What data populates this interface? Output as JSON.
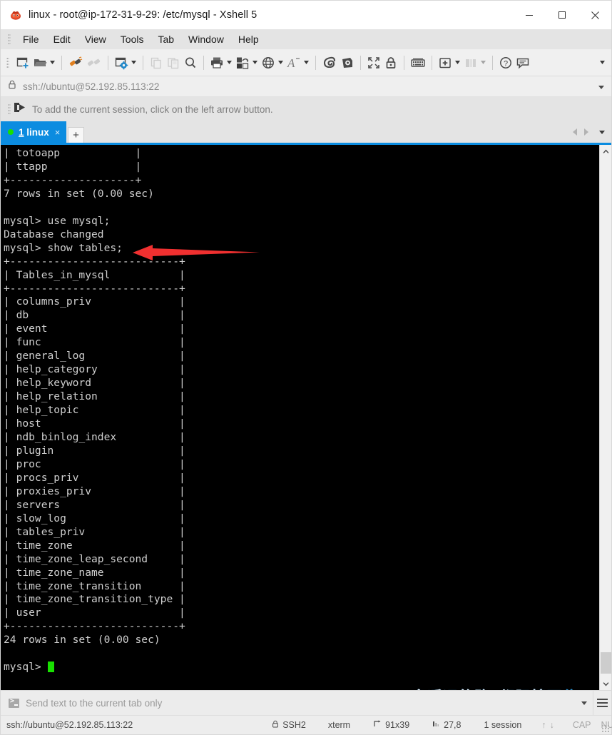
{
  "window": {
    "title": "linux - root@ip-172-31-9-29: /etc/mysql - Xshell 5",
    "app_icon": "xshell-icon",
    "minimize_label": "−",
    "maximize_label": "□",
    "close_label": "✕"
  },
  "menubar": {
    "items": [
      {
        "label": "File"
      },
      {
        "label": "Edit"
      },
      {
        "label": "View"
      },
      {
        "label": "Tools"
      },
      {
        "label": "Tab"
      },
      {
        "label": "Window"
      },
      {
        "label": "Help"
      }
    ]
  },
  "toolbar": {
    "items": [
      {
        "icon": "new-session-icon",
        "caret": false
      },
      {
        "icon": "open-folder-icon",
        "caret": true
      },
      {
        "sep": true
      },
      {
        "icon": "connect-plug-icon",
        "caret": false
      },
      {
        "icon": "disconnect-plug-icon",
        "caret": false
      },
      {
        "sep": true
      },
      {
        "icon": "session-properties-icon",
        "caret": true
      },
      {
        "sep": true
      },
      {
        "icon": "copy-icon",
        "caret": false
      },
      {
        "icon": "paste-icon",
        "caret": false
      },
      {
        "icon": "find-icon",
        "caret": false
      },
      {
        "sep": true
      },
      {
        "icon": "print-icon",
        "caret": true
      },
      {
        "icon": "file-transfer-icon",
        "caret": true
      },
      {
        "icon": "globe-icon",
        "caret": true
      },
      {
        "icon": "font-size-icon",
        "caret": true
      },
      {
        "sep": true
      },
      {
        "icon": "log-session-icon",
        "caret": false
      },
      {
        "icon": "record-script-icon",
        "caret": false
      },
      {
        "sep": true
      },
      {
        "icon": "fullscreen-icon",
        "caret": false
      },
      {
        "icon": "lock-icon",
        "caret": false
      },
      {
        "sep": true
      },
      {
        "icon": "keyboard-icon",
        "caret": false
      },
      {
        "sep": true
      },
      {
        "icon": "new-tab-icon",
        "caret": true
      },
      {
        "icon": "arrange-panes-icon",
        "caret": true
      },
      {
        "sep": true
      },
      {
        "icon": "help-icon",
        "caret": false
      },
      {
        "icon": "feedback-icon",
        "caret": false
      }
    ],
    "overflow_caret": "▾"
  },
  "address_bar": {
    "lock_icon": "lock-icon",
    "url": "ssh://ubuntu@52.192.85.113:22",
    "caret": "▾"
  },
  "hint_bar": {
    "icon": "add-session-icon",
    "text": "To add the current session, click on the left arrow button."
  },
  "tabs": {
    "items": [
      {
        "number": "1",
        "name": "linux",
        "close": "×",
        "status": "connected"
      }
    ],
    "add_label": "+",
    "prev_label": "◀",
    "next_label": "▶",
    "list_label": "▾"
  },
  "terminal": {
    "prompt_line": "mysql> ",
    "cursor": "block",
    "lines": [
      "| totoapp            |",
      "| ttapp              |",
      "+--------------------+",
      "7 rows in set (0.00 sec)",
      "",
      "mysql> use mysql;",
      "Database changed",
      "mysql> show tables;",
      "+---------------------------+",
      "| Tables_in_mysql           |",
      "+---------------------------+",
      "| columns_priv              |",
      "| db                        |",
      "| event                     |",
      "| func                      |",
      "| general_log               |",
      "| help_category             |",
      "| help_keyword              |",
      "| help_relation             |",
      "| help_topic                |",
      "| host                      |",
      "| ndb_binlog_index          |",
      "| plugin                    |",
      "| proc                      |",
      "| procs_priv                |",
      "| proxies_priv              |",
      "| servers                   |",
      "| slow_log                  |",
      "| tables_priv               |",
      "| time_zone                 |",
      "| time_zone_leap_second     |",
      "| time_zone_name            |",
      "| time_zone_transition      |",
      "| time_zone_transition_type |",
      "| user                      |",
      "+---------------------------+",
      "24 rows in set (0.00 sec)",
      ""
    ],
    "colors": {
      "background": "#000000",
      "foreground": "#cfcfcf",
      "cursor": "#18e000"
    }
  },
  "annotation": {
    "arrow_color": "#f03030",
    "arrow_direction": "left"
  },
  "watermark": {
    "text_part1": "多遥远的路  都阻挡不",
    "text_part2": "住"
  },
  "send_bar": {
    "icon": "command-prompt-icon",
    "placeholder": "Send text to the current tab only",
    "caret": "▾",
    "menu_icon": "hamburger-icon"
  },
  "status_bar": {
    "connection": "ssh://ubuntu@52.192.85.113:22",
    "protocol_icon": "lock-icon",
    "protocol": "SSH2",
    "terminal_type": "xterm",
    "size_icon": "size-icon",
    "size": "91x39",
    "cursor_icon": "cursor-pos-icon",
    "cursor_position": "27,8",
    "sessions": "1 session",
    "up_arrow": "↑",
    "down_arrow": "↓",
    "caps": "CAP",
    "num": "NUM"
  }
}
